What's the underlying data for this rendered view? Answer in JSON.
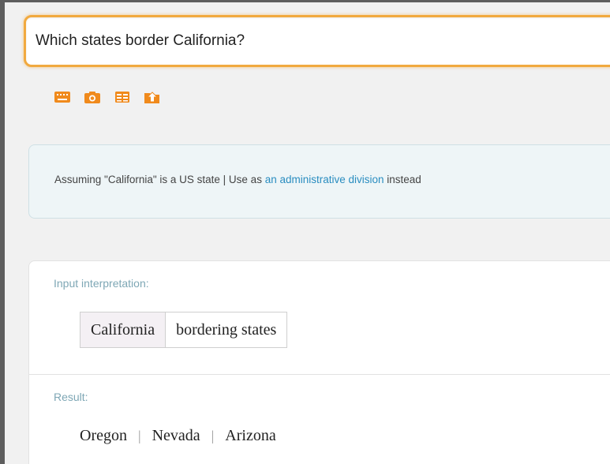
{
  "search": {
    "query": "Which states border California?"
  },
  "toolbar": {
    "icons": [
      "keyboard-icon",
      "camera-icon",
      "table-icon",
      "upload-icon"
    ],
    "accent": "#f08a1c"
  },
  "assumption": {
    "prefix": "Assuming \"California\" is a US state | Use as ",
    "link": "an administrative division",
    "suffix": " instead"
  },
  "pods": {
    "input_title": "Input interpretation:",
    "input_cells": [
      "California",
      "bordering states"
    ],
    "result_title": "Result:",
    "result_items": [
      "Oregon",
      "Nevada",
      "Arizona"
    ],
    "separator": "|"
  }
}
